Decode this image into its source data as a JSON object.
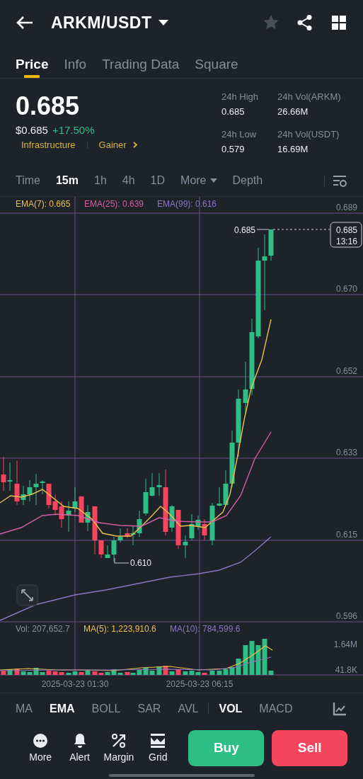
{
  "header": {
    "pair": "ARKM/USDT"
  },
  "tabs": [
    {
      "label": "Price",
      "selected": true
    },
    {
      "label": "Info",
      "selected": false
    },
    {
      "label": "Trading Data",
      "selected": false
    },
    {
      "label": "Square",
      "selected": false
    }
  ],
  "price": {
    "last": "0.685",
    "usd": "$0.685",
    "change": "+17.50%",
    "tags": [
      "Infrastructure",
      "Gainer"
    ]
  },
  "stats": [
    {
      "label": "24h High",
      "value": "0.685"
    },
    {
      "label": "24h Vol(ARKM)",
      "value": "26.66M"
    },
    {
      "label": "24h Low",
      "value": "0.579"
    },
    {
      "label": "24h Vol(USDT)",
      "value": "16.69M"
    }
  ],
  "intervals": [
    {
      "label": "Time",
      "selected": false,
      "kind": "plain"
    },
    {
      "label": "15m",
      "selected": true,
      "kind": "plain"
    },
    {
      "label": "1h",
      "selected": false,
      "kind": "plain"
    },
    {
      "label": "4h",
      "selected": false,
      "kind": "plain"
    },
    {
      "label": "1D",
      "selected": false,
      "kind": "plain"
    },
    {
      "label": "More",
      "selected": false,
      "kind": "dropdown"
    },
    {
      "label": "Depth",
      "selected": false,
      "kind": "plain"
    }
  ],
  "chart": {
    "legend": [
      {
        "label": "EMA(7): 0.665",
        "color": "#e9c14b"
      },
      {
        "label": "EMA(25): 0.639",
        "color": "#d45fa8"
      },
      {
        "label": "EMA(99): 0.616",
        "color": "#8e76c4"
      }
    ],
    "price_ticks": [
      "0.689",
      "0.670",
      "0.652",
      "0.633",
      "0.615",
      "0.596"
    ],
    "high_label": "0.685",
    "low_label": "0.610",
    "last_price": "0.685",
    "countdown": "13:16",
    "volume_legend": [
      {
        "label": "Vol: 207,652.7",
        "color": "#8a909a"
      },
      {
        "label": "MA(5): 1,223,910.6",
        "color": "#e9c14b"
      },
      {
        "label": "MA(10): 784,599.6",
        "color": "#8e76c4"
      }
    ],
    "volume_ticks": [
      "1.64M",
      "41.8K"
    ],
    "time_labels": [
      "2025-03-23 01:30",
      "2025-03-23 06:15"
    ]
  },
  "main_indicators": [
    {
      "label": "MA",
      "selected": false
    },
    {
      "label": "EMA",
      "selected": true
    },
    {
      "label": "BOLL",
      "selected": false
    },
    {
      "label": "SAR",
      "selected": false
    },
    {
      "label": "AVL",
      "selected": false
    }
  ],
  "sub_indicators": [
    {
      "label": "VOL",
      "selected": true
    },
    {
      "label": "MACD",
      "selected": false
    }
  ],
  "actions": [
    {
      "label": "More",
      "kind": "more"
    },
    {
      "label": "Alert",
      "kind": "alert"
    },
    {
      "label": "Margin",
      "kind": "margin"
    },
    {
      "label": "Grid",
      "kind": "grid"
    }
  ],
  "trade_buttons": [
    {
      "label": "Buy",
      "kind": "buy"
    },
    {
      "label": "Sell",
      "kind": "sell"
    }
  ]
}
